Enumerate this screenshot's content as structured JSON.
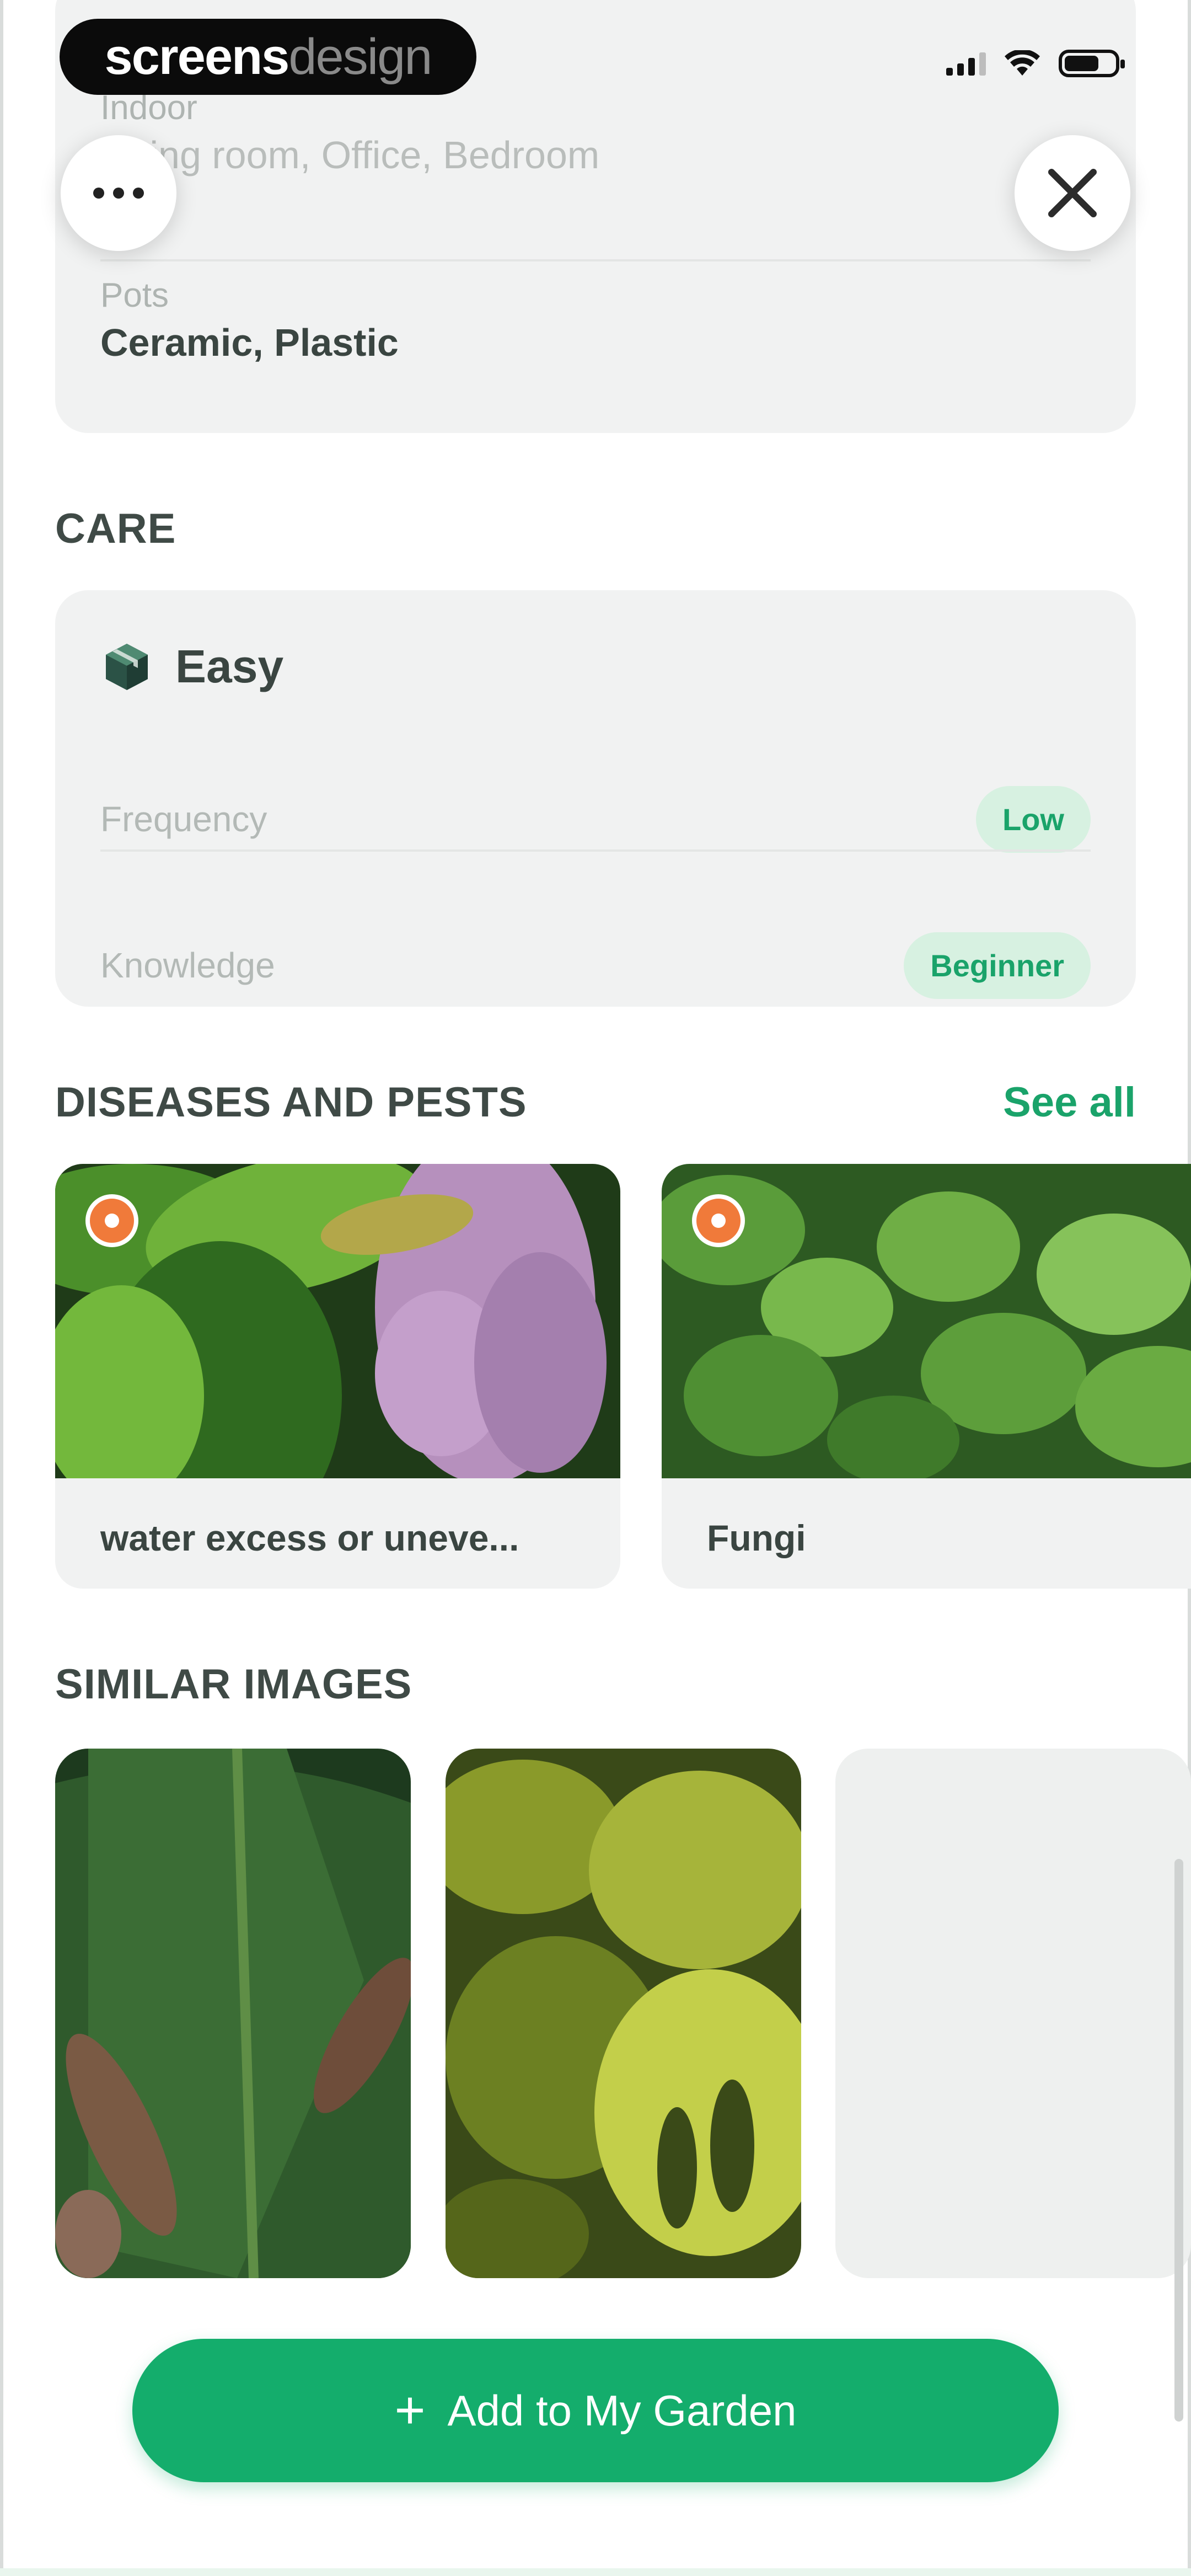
{
  "status_bar": {
    "watermark_part1": "screens",
    "watermark_part2": "design"
  },
  "top_card": {
    "partial_label": "Indoor",
    "partial_value": "Living room, Office, Bedroom",
    "pots_label": "Pots",
    "pots_value": "Ceramic, Plastic"
  },
  "care": {
    "section_title": "CARE",
    "level": "Easy",
    "rows": [
      {
        "label": "Frequency",
        "value": "Low"
      },
      {
        "label": "Knowledge",
        "value": "Beginner"
      }
    ]
  },
  "diseases": {
    "section_title": "DISEASES AND PESTS",
    "see_all": "See all",
    "items": [
      {
        "name": "water excess or uneve..."
      },
      {
        "name": "Fungi"
      }
    ]
  },
  "similar": {
    "section_title": "SIMILAR IMAGES"
  },
  "action": {
    "add_label": "Add to My Garden"
  },
  "colors": {
    "accent": "#14ad6c",
    "pill_bg": "#d7f1e1",
    "card_bg": "#f1f2f2",
    "warning": "#f07a3a"
  },
  "icons": [
    "more-icon",
    "close-icon",
    "box-icon",
    "warning-icon",
    "plus-icon"
  ]
}
